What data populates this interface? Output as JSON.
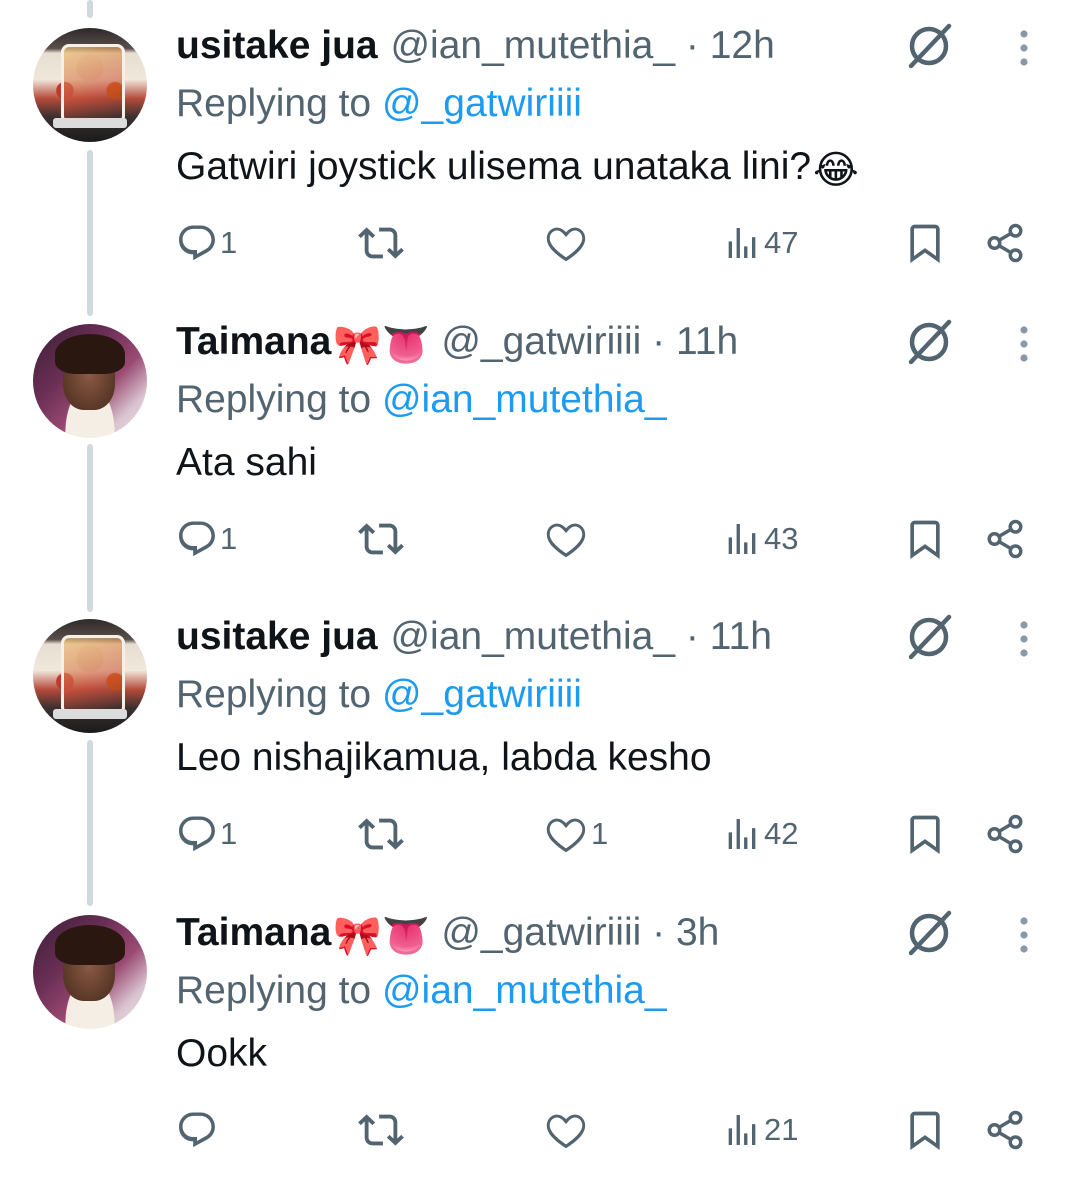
{
  "colors": {
    "text": "#0f1419",
    "muted": "#536471",
    "link": "#1d9bf0",
    "thread_line": "#cfd9de"
  },
  "tweets": [
    {
      "avatar": "bus-avatar",
      "name": "usitake jua",
      "name_emoji": "",
      "handle": "@ian_mutethia_",
      "time": "12h",
      "replying_label": "Replying to",
      "replying_to": "@_gatwiriiii",
      "text": "Gatwiri joystick ulisema unataka lini?",
      "text_emoji": "😂",
      "reply_count": "1",
      "retweet_count": "",
      "like_count": "",
      "views": "47"
    },
    {
      "avatar": "girl-avatar",
      "name": "Taimana",
      "name_emoji": "🎀👅",
      "handle": "@_gatwiriiii",
      "time": "11h",
      "replying_label": "Replying to",
      "replying_to": "@ian_mutethia_",
      "text": "Ata sahi",
      "text_emoji": "",
      "reply_count": "1",
      "retweet_count": "",
      "like_count": "",
      "views": "43"
    },
    {
      "avatar": "bus-avatar",
      "name": "usitake jua",
      "name_emoji": "",
      "handle": "@ian_mutethia_",
      "time": "11h",
      "replying_label": "Replying to",
      "replying_to": "@_gatwiriiii",
      "text": "Leo nishajikamua, labda kesho",
      "text_emoji": "",
      "reply_count": "1",
      "retweet_count": "",
      "like_count": "1",
      "views": "42"
    },
    {
      "avatar": "girl-avatar",
      "name": "Taimana",
      "name_emoji": "🎀👅",
      "handle": "@_gatwiriiii",
      "time": "3h",
      "replying_label": "Replying to",
      "replying_to": "@ian_mutethia_",
      "text": "Ookk",
      "text_emoji": "",
      "reply_count": "",
      "retweet_count": "",
      "like_count": "",
      "views": "21"
    }
  ],
  "icons": {
    "reply": "reply-icon",
    "retweet": "retweet-icon",
    "like": "heart-icon",
    "views": "views-icon",
    "bookmark": "bookmark-icon",
    "share": "share-icon",
    "grok": "grok-icon",
    "more": "more-icon"
  }
}
